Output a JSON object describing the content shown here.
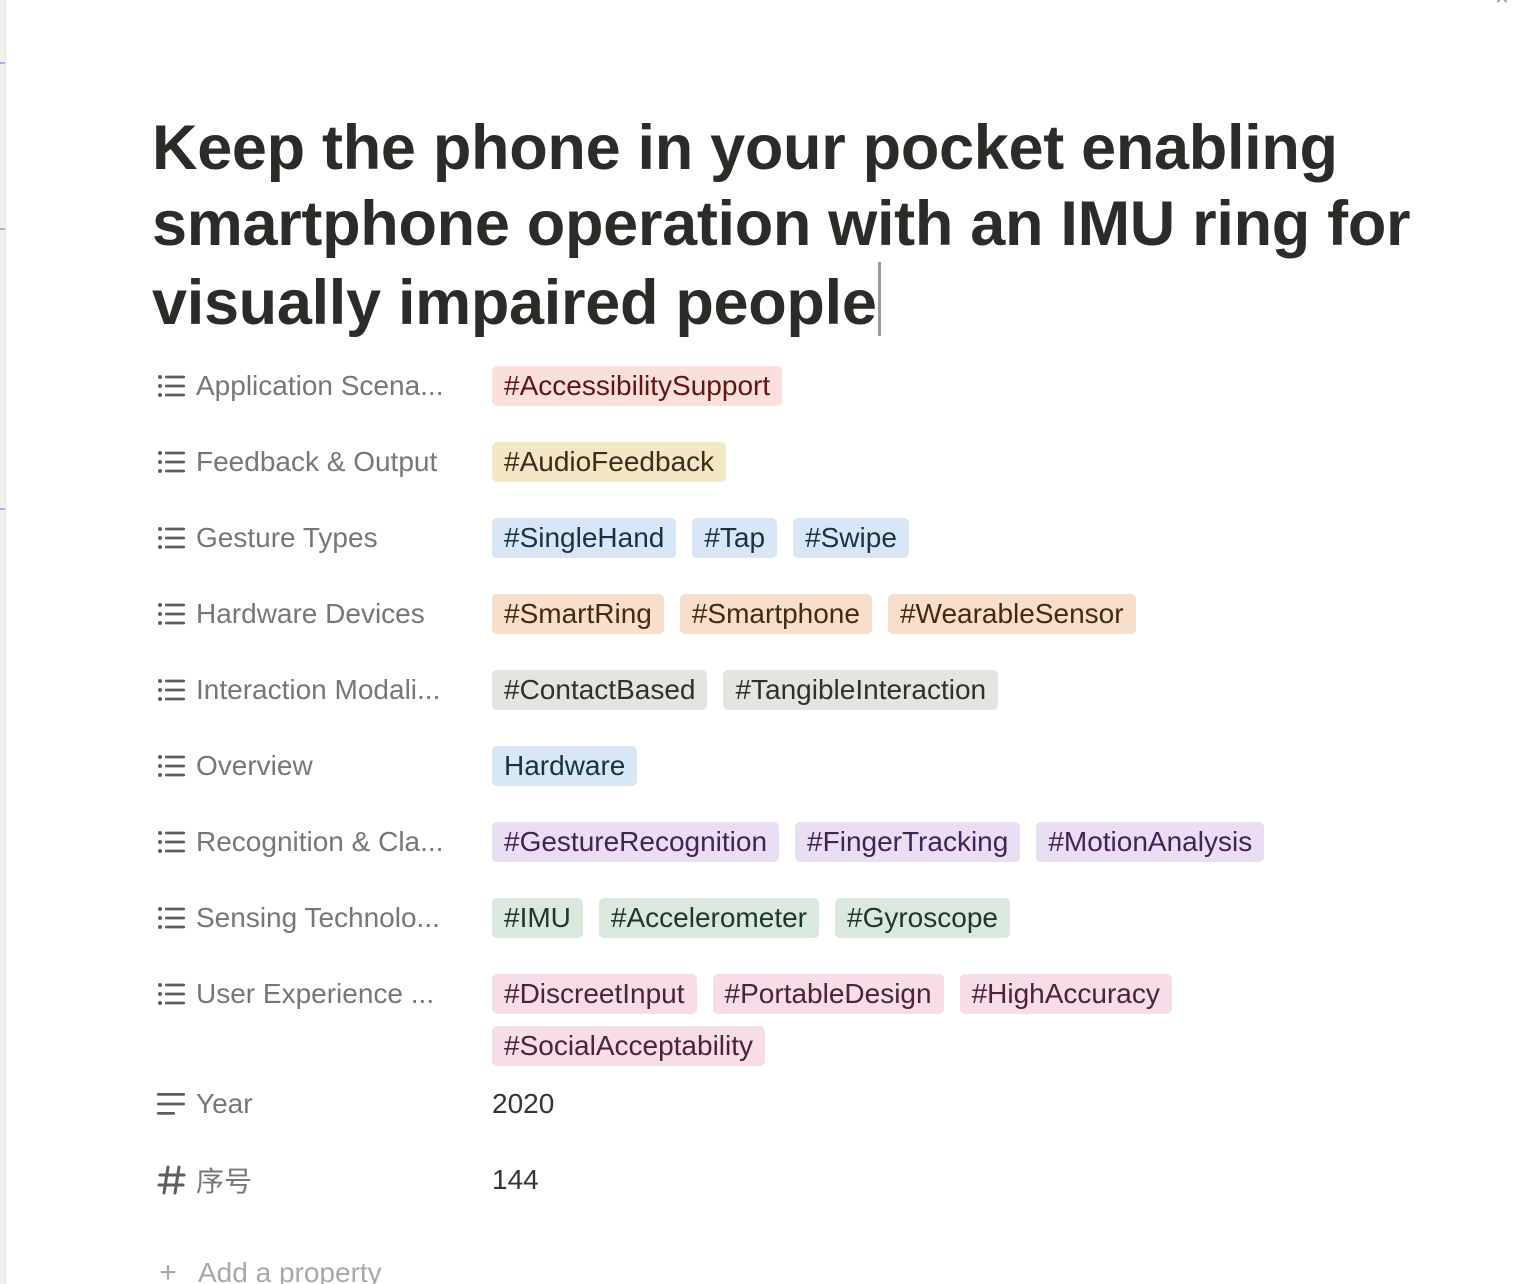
{
  "page": {
    "title": "Keep the phone in your pocket enabling smartphone operation with an IMU ring for visually impaired people"
  },
  "colors": {
    "red_tag_bg": "#fadfdb",
    "yellow_tag_bg": "#f4e7c3",
    "blue_tag_bg": "#d8e6f5",
    "orange_tag_bg": "#f7dfcb",
    "gray_tag_bg": "#e5e4e1",
    "purple_tag_bg": "#e9def4",
    "green_tag_bg": "#dbe8de",
    "pink_tag_bg": "#f6dde7"
  },
  "properties": [
    {
      "label": "Application Scena...",
      "icon": "list-icon",
      "tags": [
        {
          "text": "#AccessibilitySupport",
          "color": "red"
        }
      ]
    },
    {
      "label": "Feedback & Output",
      "icon": "list-icon",
      "tags": [
        {
          "text": "#AudioFeedback",
          "color": "yellow"
        }
      ]
    },
    {
      "label": "Gesture Types",
      "icon": "list-icon",
      "tags": [
        {
          "text": "#SingleHand",
          "color": "blue"
        },
        {
          "text": "#Tap",
          "color": "blue"
        },
        {
          "text": "#Swipe",
          "color": "blue"
        }
      ]
    },
    {
      "label": "Hardware Devices",
      "icon": "list-icon",
      "tags": [
        {
          "text": "#SmartRing",
          "color": "orange"
        },
        {
          "text": "#Smartphone",
          "color": "orange"
        },
        {
          "text": "#WearableSensor",
          "color": "orange"
        }
      ]
    },
    {
      "label": "Interaction Modali...",
      "icon": "list-icon",
      "tags": [
        {
          "text": "#ContactBased",
          "color": "gray"
        },
        {
          "text": "#TangibleInteraction",
          "color": "gray"
        }
      ]
    },
    {
      "label": "Overview",
      "icon": "list-icon",
      "tags": [
        {
          "text": "Hardware",
          "color": "blue"
        }
      ]
    },
    {
      "label": "Recognition & Cla...",
      "icon": "list-icon",
      "tags": [
        {
          "text": "#GestureRecognition",
          "color": "purple"
        },
        {
          "text": "#FingerTracking",
          "color": "purple"
        },
        {
          "text": "#MotionAnalysis",
          "color": "purple"
        }
      ]
    },
    {
      "label": "Sensing Technolo...",
      "icon": "list-icon",
      "tags": [
        {
          "text": "#IMU",
          "color": "green"
        },
        {
          "text": "#Accelerometer",
          "color": "green"
        },
        {
          "text": "#Gyroscope",
          "color": "green"
        }
      ]
    },
    {
      "label": "User Experience ...",
      "icon": "list-icon",
      "tags": [
        {
          "text": "#DiscreetInput",
          "color": "pink"
        },
        {
          "text": "#PortableDesign",
          "color": "pink"
        },
        {
          "text": "#HighAccuracy",
          "color": "pink"
        },
        {
          "text": "#SocialAcceptability",
          "color": "pink"
        }
      ]
    },
    {
      "label": "Year",
      "icon": "text-lines-icon",
      "value": "2020"
    },
    {
      "label": "序号",
      "icon": "hash-icon",
      "value": "144"
    }
  ],
  "add_property": {
    "label": "Add a property",
    "icon": "plus-icon"
  }
}
